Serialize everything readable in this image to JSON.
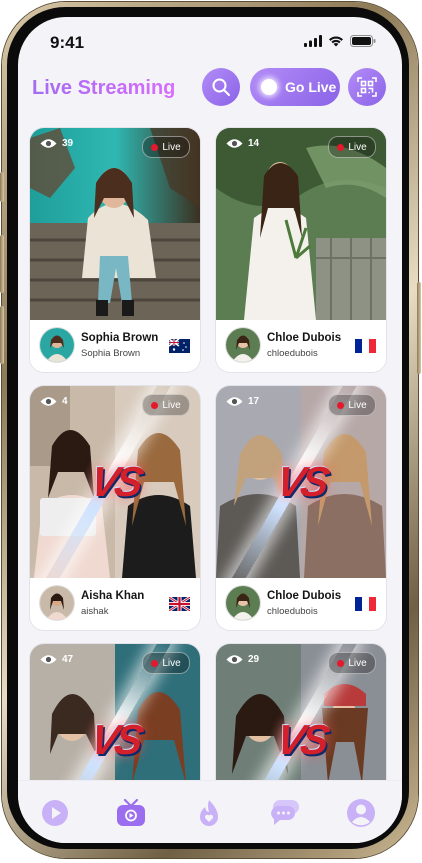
{
  "status_bar": {
    "time": "9:41"
  },
  "header": {
    "title": "Live Streaming",
    "go_live_label": "Go Live"
  },
  "streams": [
    {
      "viewers": "39",
      "live_label": "Live",
      "name": "Sophia Brown",
      "username": "Sophia Brown",
      "flag": "australia",
      "type": "single"
    },
    {
      "viewers": "14",
      "live_label": "Live",
      "name": "Chloe Dubois",
      "username": "chloedubois",
      "flag": "france",
      "type": "single"
    },
    {
      "viewers": "4",
      "live_label": "Live",
      "name": "Aisha Khan",
      "username": "aishak",
      "flag": "united-kingdom",
      "type": "versus",
      "versus_text": "VS"
    },
    {
      "viewers": "17",
      "live_label": "Live",
      "name": "Chloe Dubois",
      "username": "chloedubois",
      "flag": "france",
      "type": "versus",
      "versus_text": "VS"
    },
    {
      "viewers": "47",
      "live_label": "Live",
      "type": "versus",
      "versus_text": "VS"
    },
    {
      "viewers": "29",
      "live_label": "Live",
      "type": "versus",
      "versus_text": "VS"
    }
  ],
  "bottom_nav": [
    {
      "icon": "play-icon",
      "active": false
    },
    {
      "icon": "live-tv-icon",
      "active": true
    },
    {
      "icon": "trending-flame-icon",
      "active": false
    },
    {
      "icon": "chat-icon",
      "active": false
    },
    {
      "icon": "profile-icon",
      "active": false
    }
  ],
  "colors": {
    "accent": "#9b6ef0",
    "accent_light": "#c9b1f7",
    "live_red": "#e5182c",
    "vs_red": "#d3202a",
    "vs_blue": "#2f64d8"
  }
}
